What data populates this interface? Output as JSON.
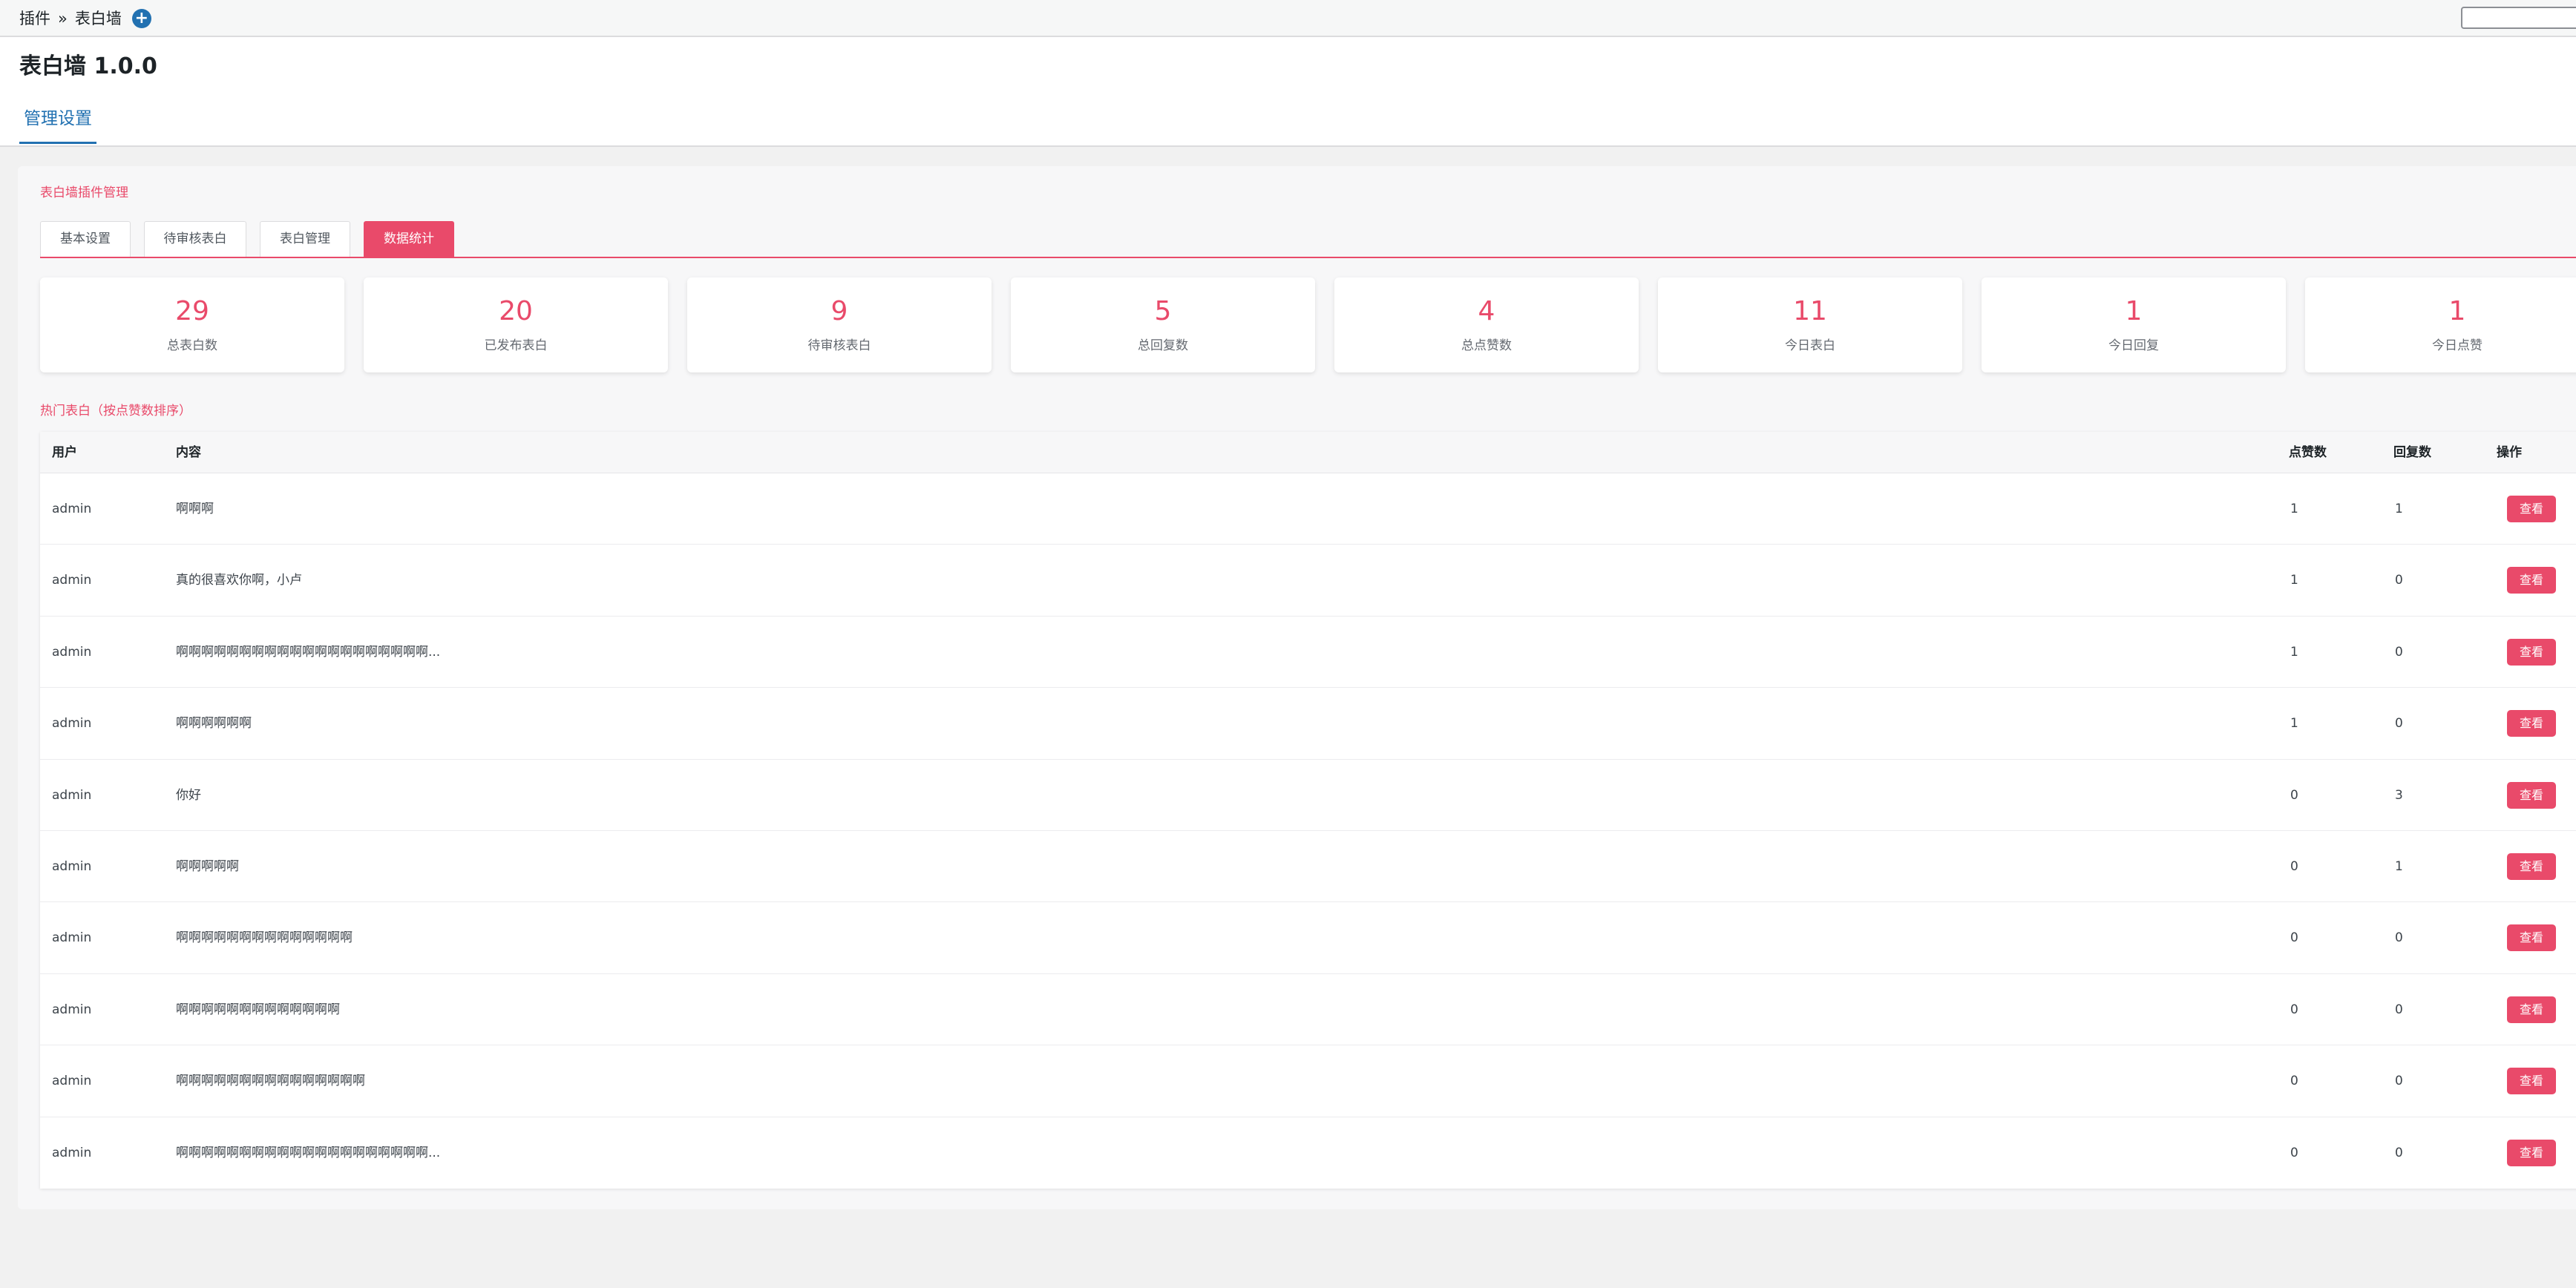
{
  "topbar": {
    "breadcrumb_parent": "插件",
    "breadcrumb_separator": "»",
    "breadcrumb_current": "表白墙",
    "add_icon": "plus-circle-icon"
  },
  "header": {
    "title": "表白墙 1.0.0",
    "tabs": [
      {
        "label": "管理设置",
        "active": true
      }
    ]
  },
  "panel": {
    "title": "表白墙插件管理",
    "subtabs": [
      {
        "label": "基本设置",
        "active": false
      },
      {
        "label": "待审核表白",
        "active": false
      },
      {
        "label": "表白管理",
        "active": false
      },
      {
        "label": "数据统计",
        "active": true
      }
    ],
    "stats": [
      {
        "value": "29",
        "label": "总表白数"
      },
      {
        "value": "20",
        "label": "已发布表白"
      },
      {
        "value": "9",
        "label": "待审核表白"
      },
      {
        "value": "5",
        "label": "总回复数"
      },
      {
        "value": "4",
        "label": "总点赞数"
      },
      {
        "value": "11",
        "label": "今日表白"
      },
      {
        "value": "1",
        "label": "今日回复"
      },
      {
        "value": "1",
        "label": "今日点赞"
      }
    ],
    "hot_title": "热门表白（按点赞数排序）",
    "table": {
      "columns": [
        "用户",
        "内容",
        "点赞数",
        "回复数",
        "操作"
      ],
      "view_label": "查看",
      "rows": [
        {
          "user": "admin",
          "content": "啊啊啊",
          "likes": "1",
          "replies": "1"
        },
        {
          "user": "admin",
          "content": "真的很喜欢你啊，小卢",
          "likes": "1",
          "replies": "0"
        },
        {
          "user": "admin",
          "content": "啊啊啊啊啊啊啊啊啊啊啊啊啊啊啊啊啊啊啊啊...",
          "likes": "1",
          "replies": "0"
        },
        {
          "user": "admin",
          "content": "啊啊啊啊啊啊",
          "likes": "1",
          "replies": "0"
        },
        {
          "user": "admin",
          "content": "你好",
          "likes": "0",
          "replies": "3"
        },
        {
          "user": "admin",
          "content": "啊啊啊啊啊",
          "likes": "0",
          "replies": "1"
        },
        {
          "user": "admin",
          "content": "啊啊啊啊啊啊啊啊啊啊啊啊啊啊",
          "likes": "0",
          "replies": "0"
        },
        {
          "user": "admin",
          "content": "啊啊啊啊啊啊啊啊啊啊啊啊啊",
          "likes": "0",
          "replies": "0"
        },
        {
          "user": "admin",
          "content": "啊啊啊啊啊啊啊啊啊啊啊啊啊啊啊",
          "likes": "0",
          "replies": "0"
        },
        {
          "user": "admin",
          "content": "啊啊啊啊啊啊啊啊啊啊啊啊啊啊啊啊啊啊啊啊...",
          "likes": "0",
          "replies": "0"
        }
      ]
    }
  },
  "colors": {
    "accent": "#e94a6a",
    "link_blue": "#2271b1",
    "background": "#f1f1f1"
  }
}
